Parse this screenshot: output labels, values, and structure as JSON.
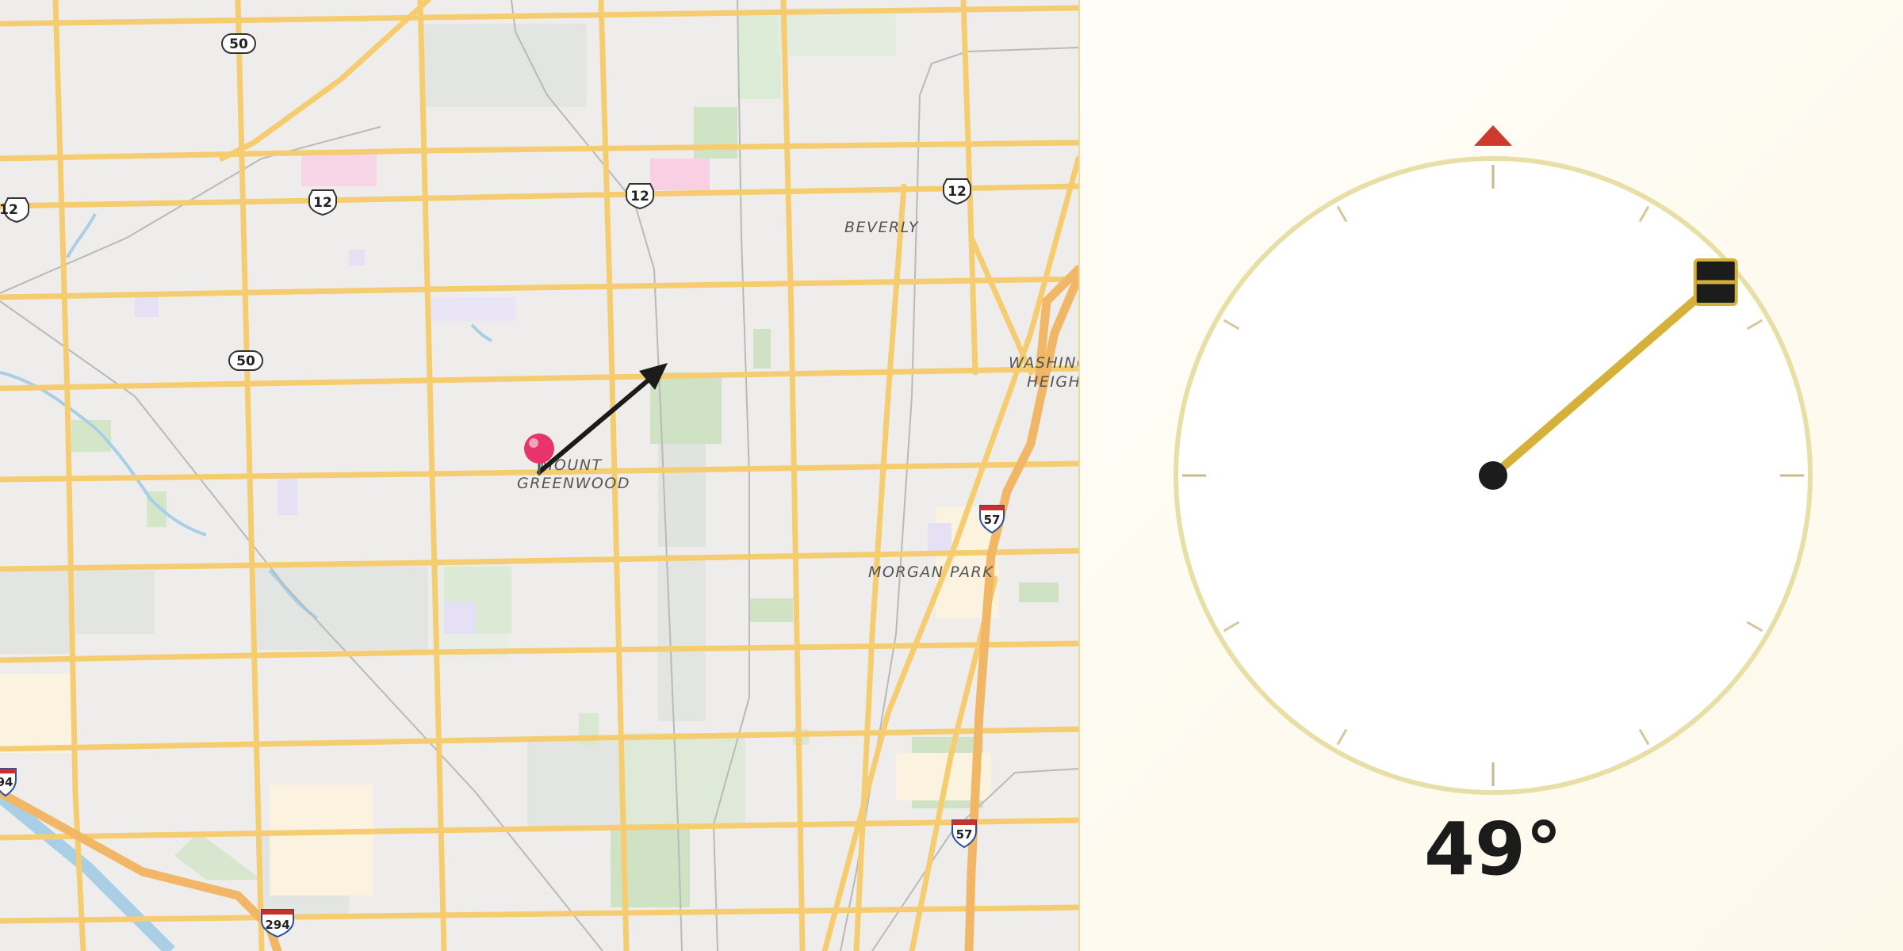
{
  "map": {
    "places": {
      "beverly": "BEVERLY",
      "washington_heights_1": "WASHING",
      "washington_heights_2": "HEIGH",
      "mount_greenwood_1": "MOUNT",
      "mount_greenwood_2": "GREENWOOD",
      "morgan_park": "MORGAN PARK"
    },
    "shields": {
      "us12_a": "12",
      "us12_b": "12",
      "us12_c": "12",
      "us12_d": "12",
      "r50_a": "50",
      "r50_b": "50",
      "i57_a": "57",
      "i57_b": "57",
      "i294_a": "294",
      "i294_b": "94"
    },
    "marker_icon": "map-pin-icon",
    "heading_arrow_icon": "direction-arrow-icon"
  },
  "compass": {
    "heading_degrees": 49,
    "readout": "49°",
    "north_marker_icon": "north-triangle-icon",
    "needle_handle_icon": "needle-handle-icon",
    "colors": {
      "ring": "#e8dfa6",
      "needle": "#d6b13a",
      "north": "#cf3a2e",
      "hub": "#1c1c1c"
    }
  }
}
